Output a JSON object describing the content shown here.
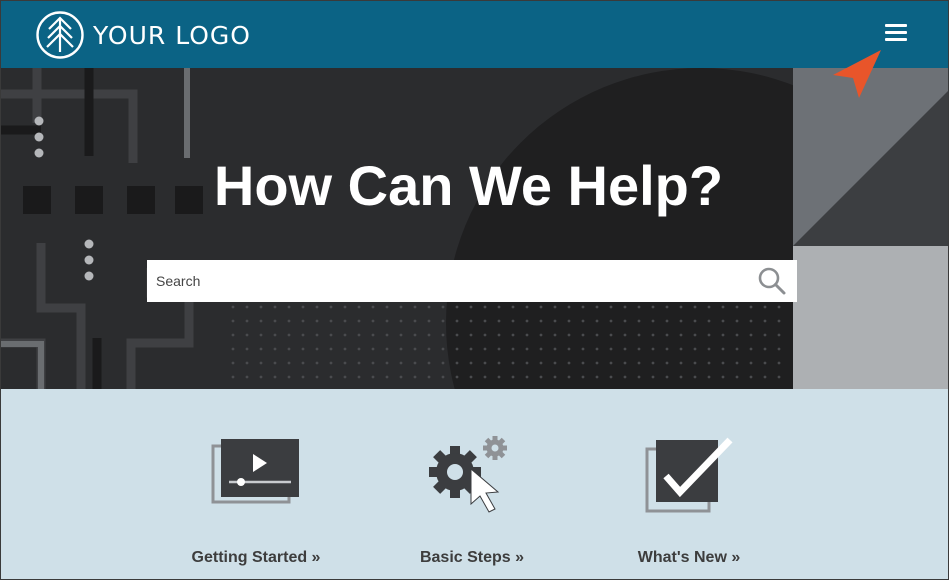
{
  "header": {
    "logo_text": "YOUR LOGO",
    "logo_icon": "tree-icon",
    "menu_icon": "hamburger-menu-icon",
    "background_color": "#0b6385"
  },
  "hero": {
    "title": "How Can We Help?",
    "search": {
      "placeholder": "Search",
      "value": "",
      "icon": "search-icon"
    }
  },
  "tiles": [
    {
      "label": "Getting Started »",
      "icon": "video-player-icon"
    },
    {
      "label": "Basic Steps »",
      "icon": "gears-cursor-icon"
    },
    {
      "label": "What's New »",
      "icon": "checkmark-window-icon"
    }
  ],
  "colors": {
    "accent_arrow": "#e8552a",
    "tiles_background": "#cfe0e8",
    "hero_background": "#242526"
  }
}
